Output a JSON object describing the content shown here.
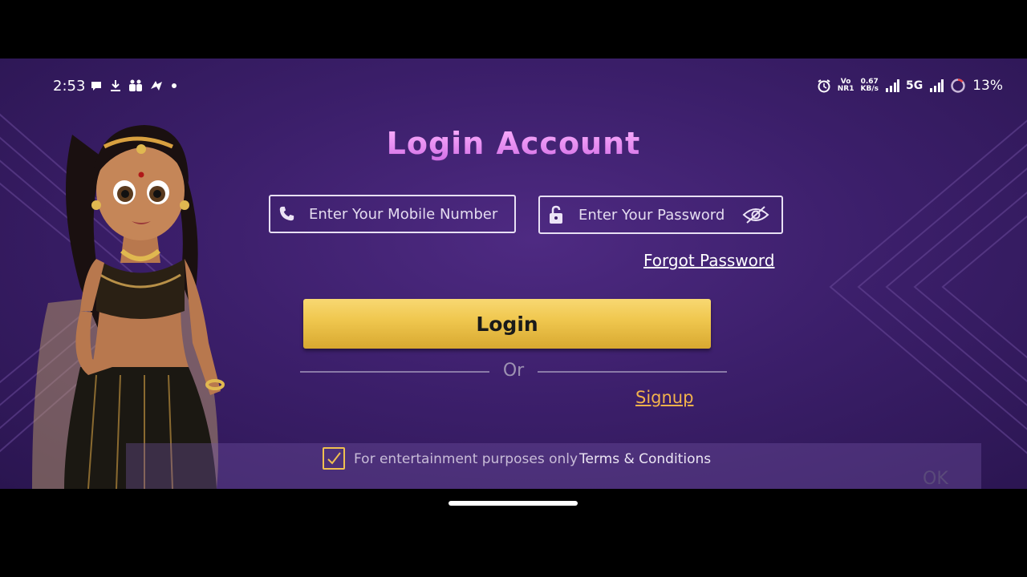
{
  "status_bar": {
    "time": "2:53",
    "left_icons": [
      "chat-bubble-icon",
      "download-icon",
      "teams-icon",
      "app-icon",
      "dot-icon"
    ],
    "network_speed_top": "0.67",
    "network_speed_bottom": "KB/s",
    "volte_top": "Vo",
    "volte_bottom": "NR1",
    "network_type": "5G",
    "battery": "13%"
  },
  "login": {
    "title": "Login Account",
    "mobile_placeholder": "Enter Your Mobile Number",
    "mobile_value": "",
    "password_placeholder": "Enter Your Password",
    "password_value": "",
    "forgot_label": "Forgot Password",
    "login_label": "Login",
    "or_label": "Or",
    "signup_label": "Signup"
  },
  "footer": {
    "checked": true,
    "entertainment_text": "For entertainment purposes only",
    "terms_label": "Terms & Conditions",
    "ok_label": "OK"
  },
  "colors": {
    "background": "#3c1f6b",
    "accent_gold": "#f0c850",
    "title_pink": "#e48cf2",
    "signup": "#f2b24c"
  }
}
